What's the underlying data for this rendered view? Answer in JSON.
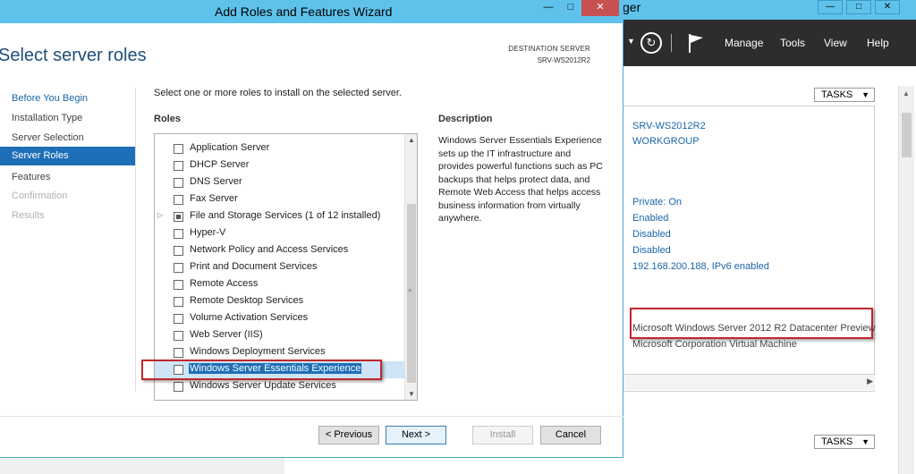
{
  "server_manager": {
    "title_fragment": "ger",
    "window_buttons": [
      "—",
      "□",
      "✕"
    ],
    "toolbar": {
      "refresh_icon": "refresh-icon",
      "flag_icon": "flag-icon",
      "menu": [
        "Manage",
        "Tools",
        "View",
        "Help"
      ]
    },
    "tasks_label": "TASKS",
    "properties": {
      "computer_name": "SRV-WS2012R2",
      "workgroup": "WORKGROUP",
      "firewall": "Private: On",
      "remote_mgmt": "Enabled",
      "remote_desktop": "Disabled",
      "nic_teaming": "Disabled",
      "ethernet": "192.168.200.188, IPv6 enabled",
      "os": "Microsoft Windows Server 2012 R2 Datacenter Preview",
      "hardware": "Microsoft Corporation Virtual Machine"
    }
  },
  "wizard": {
    "title": "Add Roles and Features Wizard",
    "window_buttons": {
      "minimize": "—",
      "maximize": "□",
      "close": "✕"
    },
    "heading": "Select server roles",
    "destination_label": "DESTINATION SERVER",
    "destination_value": "SRV-WS2012R2",
    "nav": [
      {
        "label": "Before You Begin",
        "state": "link"
      },
      {
        "label": "Installation Type",
        "state": "normal"
      },
      {
        "label": "Server Selection",
        "state": "normal"
      },
      {
        "label": "Server Roles",
        "state": "active"
      },
      {
        "label": "Features",
        "state": "normal"
      },
      {
        "label": "Confirmation",
        "state": "disabled"
      },
      {
        "label": "Results",
        "state": "disabled"
      }
    ],
    "intro": "Select one or more roles to install on the selected server.",
    "roles_label": "Roles",
    "description_label": "Description",
    "description_text": "Windows Server Essentials Experience sets up the IT infrastructure and provides powerful functions such as PC backups that helps protect data, and Remote Web Access that helps access business information from virtually anywhere.",
    "roles": [
      {
        "label": "Application Server",
        "checked": false
      },
      {
        "label": "DHCP Server",
        "checked": false
      },
      {
        "label": "DNS Server",
        "checked": false
      },
      {
        "label": "Fax Server",
        "checked": false
      },
      {
        "label": "File and Storage Services (1 of 12 installed)",
        "checked": "partial",
        "expandable": true
      },
      {
        "label": "Hyper-V",
        "checked": false
      },
      {
        "label": "Network Policy and Access Services",
        "checked": false
      },
      {
        "label": "Print and Document Services",
        "checked": false
      },
      {
        "label": "Remote Access",
        "checked": false
      },
      {
        "label": "Remote Desktop Services",
        "checked": false
      },
      {
        "label": "Volume Activation Services",
        "checked": false
      },
      {
        "label": "Web Server (IIS)",
        "checked": false
      },
      {
        "label": "Windows Deployment Services",
        "checked": false
      },
      {
        "label": "Windows Server Essentials Experience",
        "checked": false,
        "selected": true
      },
      {
        "label": "Windows Server Update Services",
        "checked": false
      }
    ],
    "buttons": {
      "previous": "< Previous",
      "next": "Next >",
      "install": "Install",
      "cancel": "Cancel"
    }
  }
}
